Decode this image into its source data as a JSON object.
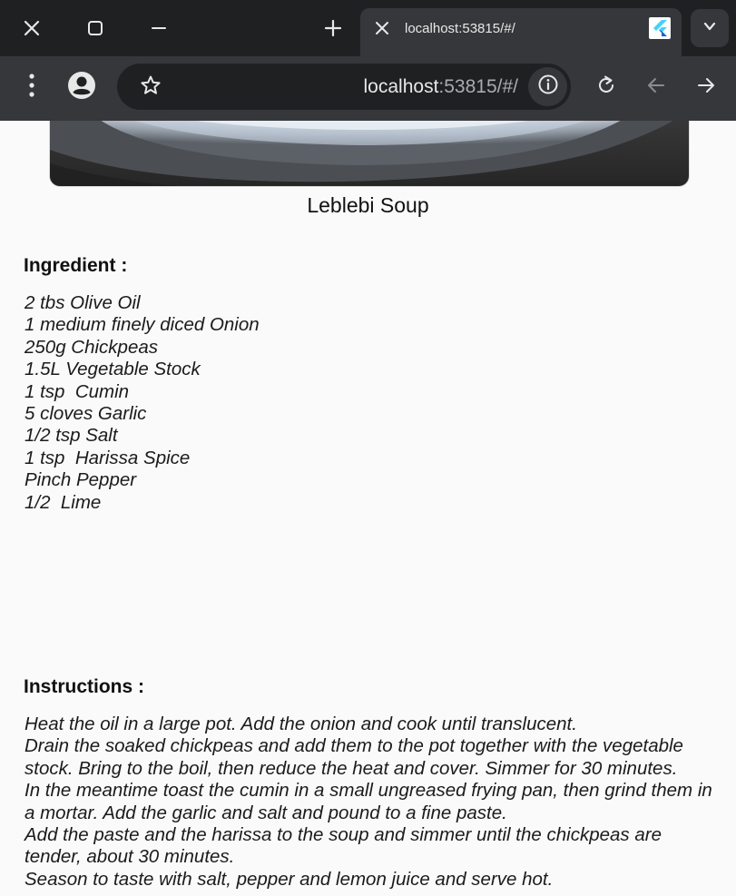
{
  "browser": {
    "tab": {
      "title": "localhost:53815/#/",
      "favicon": "flutter-icon"
    },
    "address_bar": {
      "host": "localhost",
      "rest": ":53815/#/"
    },
    "icons": {
      "window_close": "close-icon",
      "window_restore": "restore-icon",
      "window_minimize": "minimize-icon",
      "new_tab": "plus-icon",
      "tab_close": "close-icon",
      "tab_list": "chevron-down-icon",
      "menu": "kebab-menu-icon",
      "profile": "profile-icon",
      "bookmark": "star-icon",
      "site_info": "info-icon",
      "reload": "reload-icon",
      "back": "arrow-left-icon",
      "forward": "arrow-right-icon"
    },
    "colors": {
      "tabstrip_bg": "#1f2022",
      "toolbar_bg": "#36373a",
      "page_bg": "#fafafa"
    }
  },
  "recipe": {
    "title": "Leblebi Soup",
    "ingredients_heading": "Ingredient :",
    "ingredients": [
      "2 tbs Olive Oil",
      "1 medium finely diced Onion",
      "250g Chickpeas",
      "1.5L Vegetable Stock",
      "1 tsp  Cumin",
      "5 cloves Garlic",
      "1/2 tsp Salt",
      "1 tsp  Harissa Spice",
      "Pinch Pepper",
      "1/2  Lime"
    ],
    "instructions_heading": "Instructions :",
    "instructions": [
      "Heat the oil in a large pot. Add the onion and cook until translucent.",
      "Drain the soaked chickpeas and add them to the pot together with the vegetable stock. Bring to the boil, then reduce the heat and cover. Simmer for 30 minutes.",
      "In the meantime toast the cumin in a small ungreased frying pan, then grind them in a mortar. Add the garlic and salt and pound to a fine paste.",
      "Add the paste and the harissa to the soup and simmer until the chickpeas are tender, about 30 minutes.",
      "Season to taste with salt, pepper and lemon juice and serve hot."
    ]
  }
}
